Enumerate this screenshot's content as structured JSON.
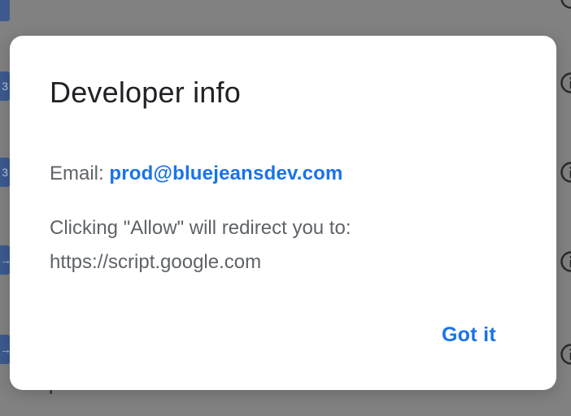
{
  "background": {
    "partial_text": "present",
    "icons": [
      "apps-script-icon",
      "info-icon"
    ]
  },
  "dialog": {
    "title": "Developer info",
    "email_label": "Email:",
    "email_value": "prod@bluejeansdev.com",
    "redirect_line1": "Clicking \"Allow\" will redirect you to:",
    "redirect_line2": "https://script.google.com",
    "got_it_label": "Got it"
  },
  "colors": {
    "accent": "#1a73e8",
    "title": "#202124",
    "body_text": "#5f6368",
    "scrim": "#818181"
  }
}
